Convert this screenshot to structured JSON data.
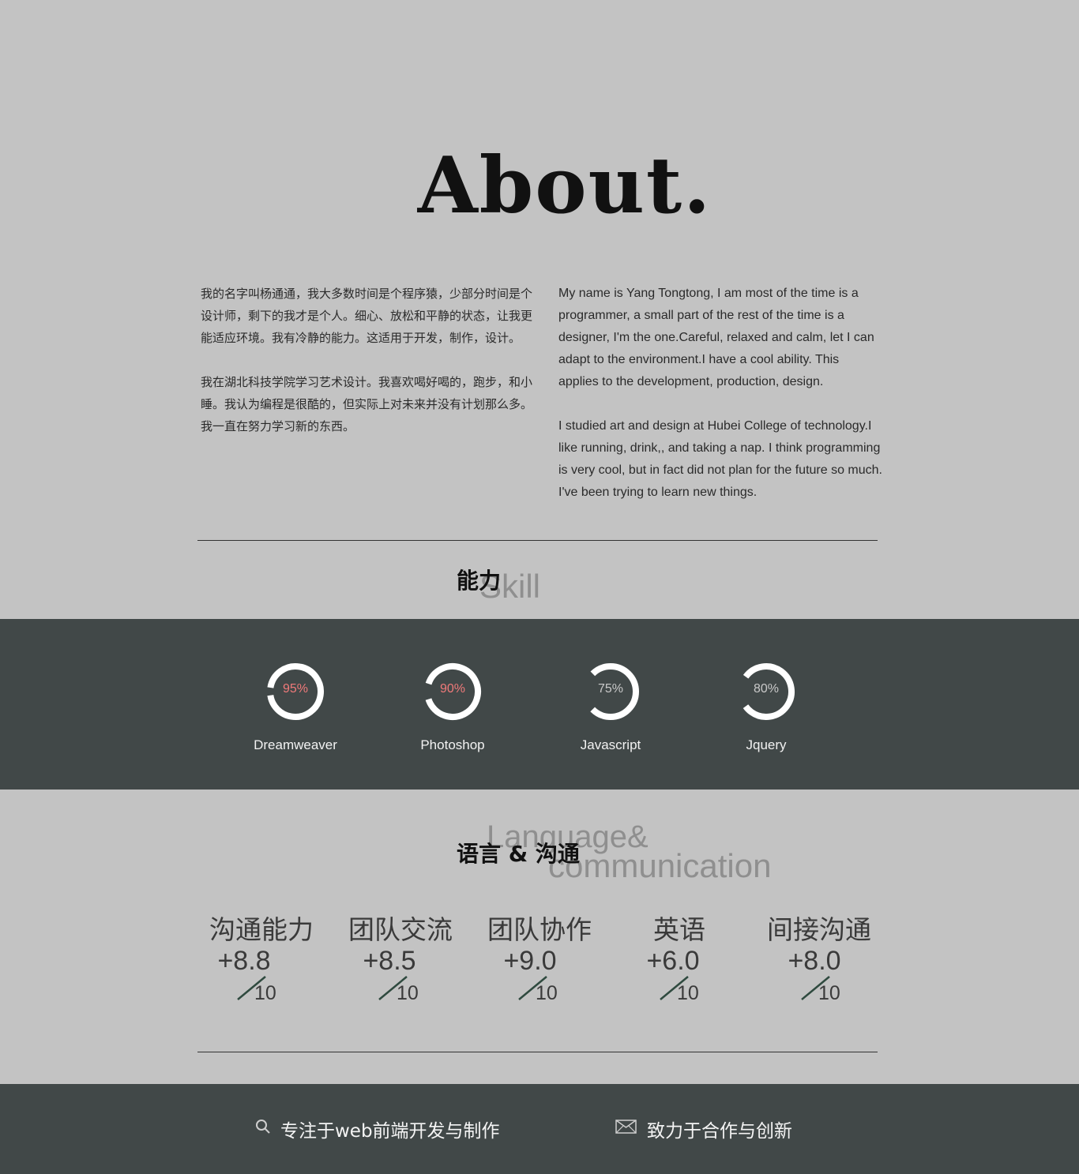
{
  "about": {
    "title": "About."
  },
  "intro": {
    "cn_paragraphs": [
      "我的名字叫杨通通，我大多数时间是个程序猿，少部分时间是个设计师，剩下的我才是个人。细心、放松和平静的状态，让我更能适应环境。我有冷静的能力。这适用于开发，制作，设计。",
      "我在湖北科技学院学习艺术设计。我喜欢喝好喝的，跑步，和小睡。我认为编程是很酷的，但实际上对未来并没有计划那么多。我一直在努力学习新的东西。"
    ],
    "en_paragraphs": [
      "My name is Yang Tongtong, I am most of the time is a programmer, a small part of the rest of the time is a designer, I'm the one.Careful, relaxed and calm, let I can adapt to the environment.I have a cool ability. This applies to the development, production, design.",
      "I studied art and design at Hubei College of technology.I like running, drink,, and taking a nap. I think programming is very cool, but in fact did not plan for the future so much. I've been trying to learn new things."
    ]
  },
  "skill_section": {
    "heading_cn": "能力",
    "heading_en": "Skill"
  },
  "skills": [
    {
      "name": "Dreamweaver",
      "percent_label": "95%",
      "value": 95,
      "label_color": "#f07a7a"
    },
    {
      "name": "Photoshop",
      "percent_label": "90%",
      "value": 90,
      "label_color": "#f07a7a"
    },
    {
      "name": "Javascript",
      "percent_label": "75%",
      "value": 75,
      "label_color": "#c9c9c9"
    },
    {
      "name": "Jquery",
      "percent_label": "80%",
      "value": 80,
      "label_color": "#c9c9c9"
    }
  ],
  "language_section": {
    "heading_cn": "语言 & 沟通",
    "heading_en_line1": "Language&",
    "heading_en_line2": "communication"
  },
  "stats": [
    {
      "label": "沟通能力",
      "score": "+8.8",
      "denominator": "10"
    },
    {
      "label": "团队交流",
      "score": "+8.5",
      "denominator": "10"
    },
    {
      "label": "团队协作",
      "score": "+9.0",
      "denominator": "10"
    },
    {
      "label": "英语",
      "score": "+6.0",
      "denominator": "10"
    },
    {
      "label": "间接沟通",
      "score": "+8.0",
      "denominator": "10"
    }
  ],
  "footer": {
    "item1": {
      "icon": "search-icon",
      "text": "专注于web前端开发与制作"
    },
    "item2": {
      "icon": "mail-icon",
      "text": "致力于合作与创新"
    }
  },
  "colors": {
    "background": "#c3c3c3",
    "band": "#414848",
    "ring": "#ffffff",
    "slash": "#2f4a3f"
  }
}
